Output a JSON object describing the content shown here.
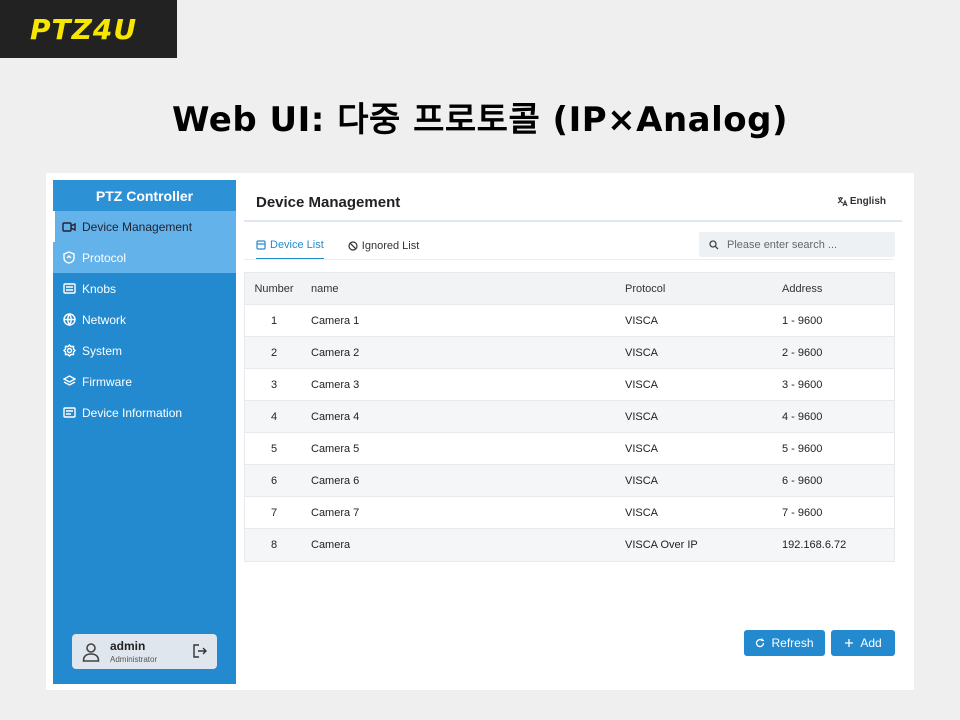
{
  "slide": {
    "logo": "PTZ4U",
    "title": "Web UI: 다중 프로토콜 (IP×Analog)"
  },
  "sidebar": {
    "title": "PTZ Controller",
    "items": [
      {
        "label": "Device Management",
        "icon": "camera-icon"
      },
      {
        "label": "Protocol",
        "icon": "shield-icon"
      },
      {
        "label": "Knobs",
        "icon": "keyboard-icon"
      },
      {
        "label": "Network",
        "icon": "globe-icon"
      },
      {
        "label": "System",
        "icon": "gear-icon"
      },
      {
        "label": "Firmware",
        "icon": "layers-icon"
      },
      {
        "label": "Device Information",
        "icon": "info-panel-icon"
      }
    ],
    "user": {
      "name": "admin",
      "role": "Administrator"
    }
  },
  "header": {
    "title": "Device Management",
    "language": "English"
  },
  "tabs": [
    {
      "label": "Device List"
    },
    {
      "label": "Ignored List"
    }
  ],
  "search": {
    "placeholder": "Please enter search ..."
  },
  "table": {
    "headers": {
      "number": "Number",
      "name": "name",
      "protocol": "Protocol",
      "address": "Address"
    },
    "rows": [
      {
        "number": "1",
        "name": "Camera 1",
        "protocol": "VISCA",
        "address": "1 - 9600"
      },
      {
        "number": "2",
        "name": "Camera 2",
        "protocol": "VISCA",
        "address": "2 - 9600"
      },
      {
        "number": "3",
        "name": "Camera 3",
        "protocol": "VISCA",
        "address": "3 - 9600"
      },
      {
        "number": "4",
        "name": "Camera 4",
        "protocol": "VISCA",
        "address": "4 - 9600"
      },
      {
        "number": "5",
        "name": "Camera 5",
        "protocol": "VISCA",
        "address": "5 - 9600"
      },
      {
        "number": "6",
        "name": "Camera 6",
        "protocol": "VISCA",
        "address": "6 - 9600"
      },
      {
        "number": "7",
        "name": "Camera 7",
        "protocol": "VISCA",
        "address": "7 - 9600"
      },
      {
        "number": "8",
        "name": "Camera",
        "protocol": "VISCA Over IP",
        "address": "192.168.6.72"
      }
    ]
  },
  "actions": {
    "refresh": "Refresh",
    "add": "Add"
  },
  "colors": {
    "accent": "#238ad0",
    "logo_bg": "#222222",
    "logo_text": "#f6e600"
  }
}
